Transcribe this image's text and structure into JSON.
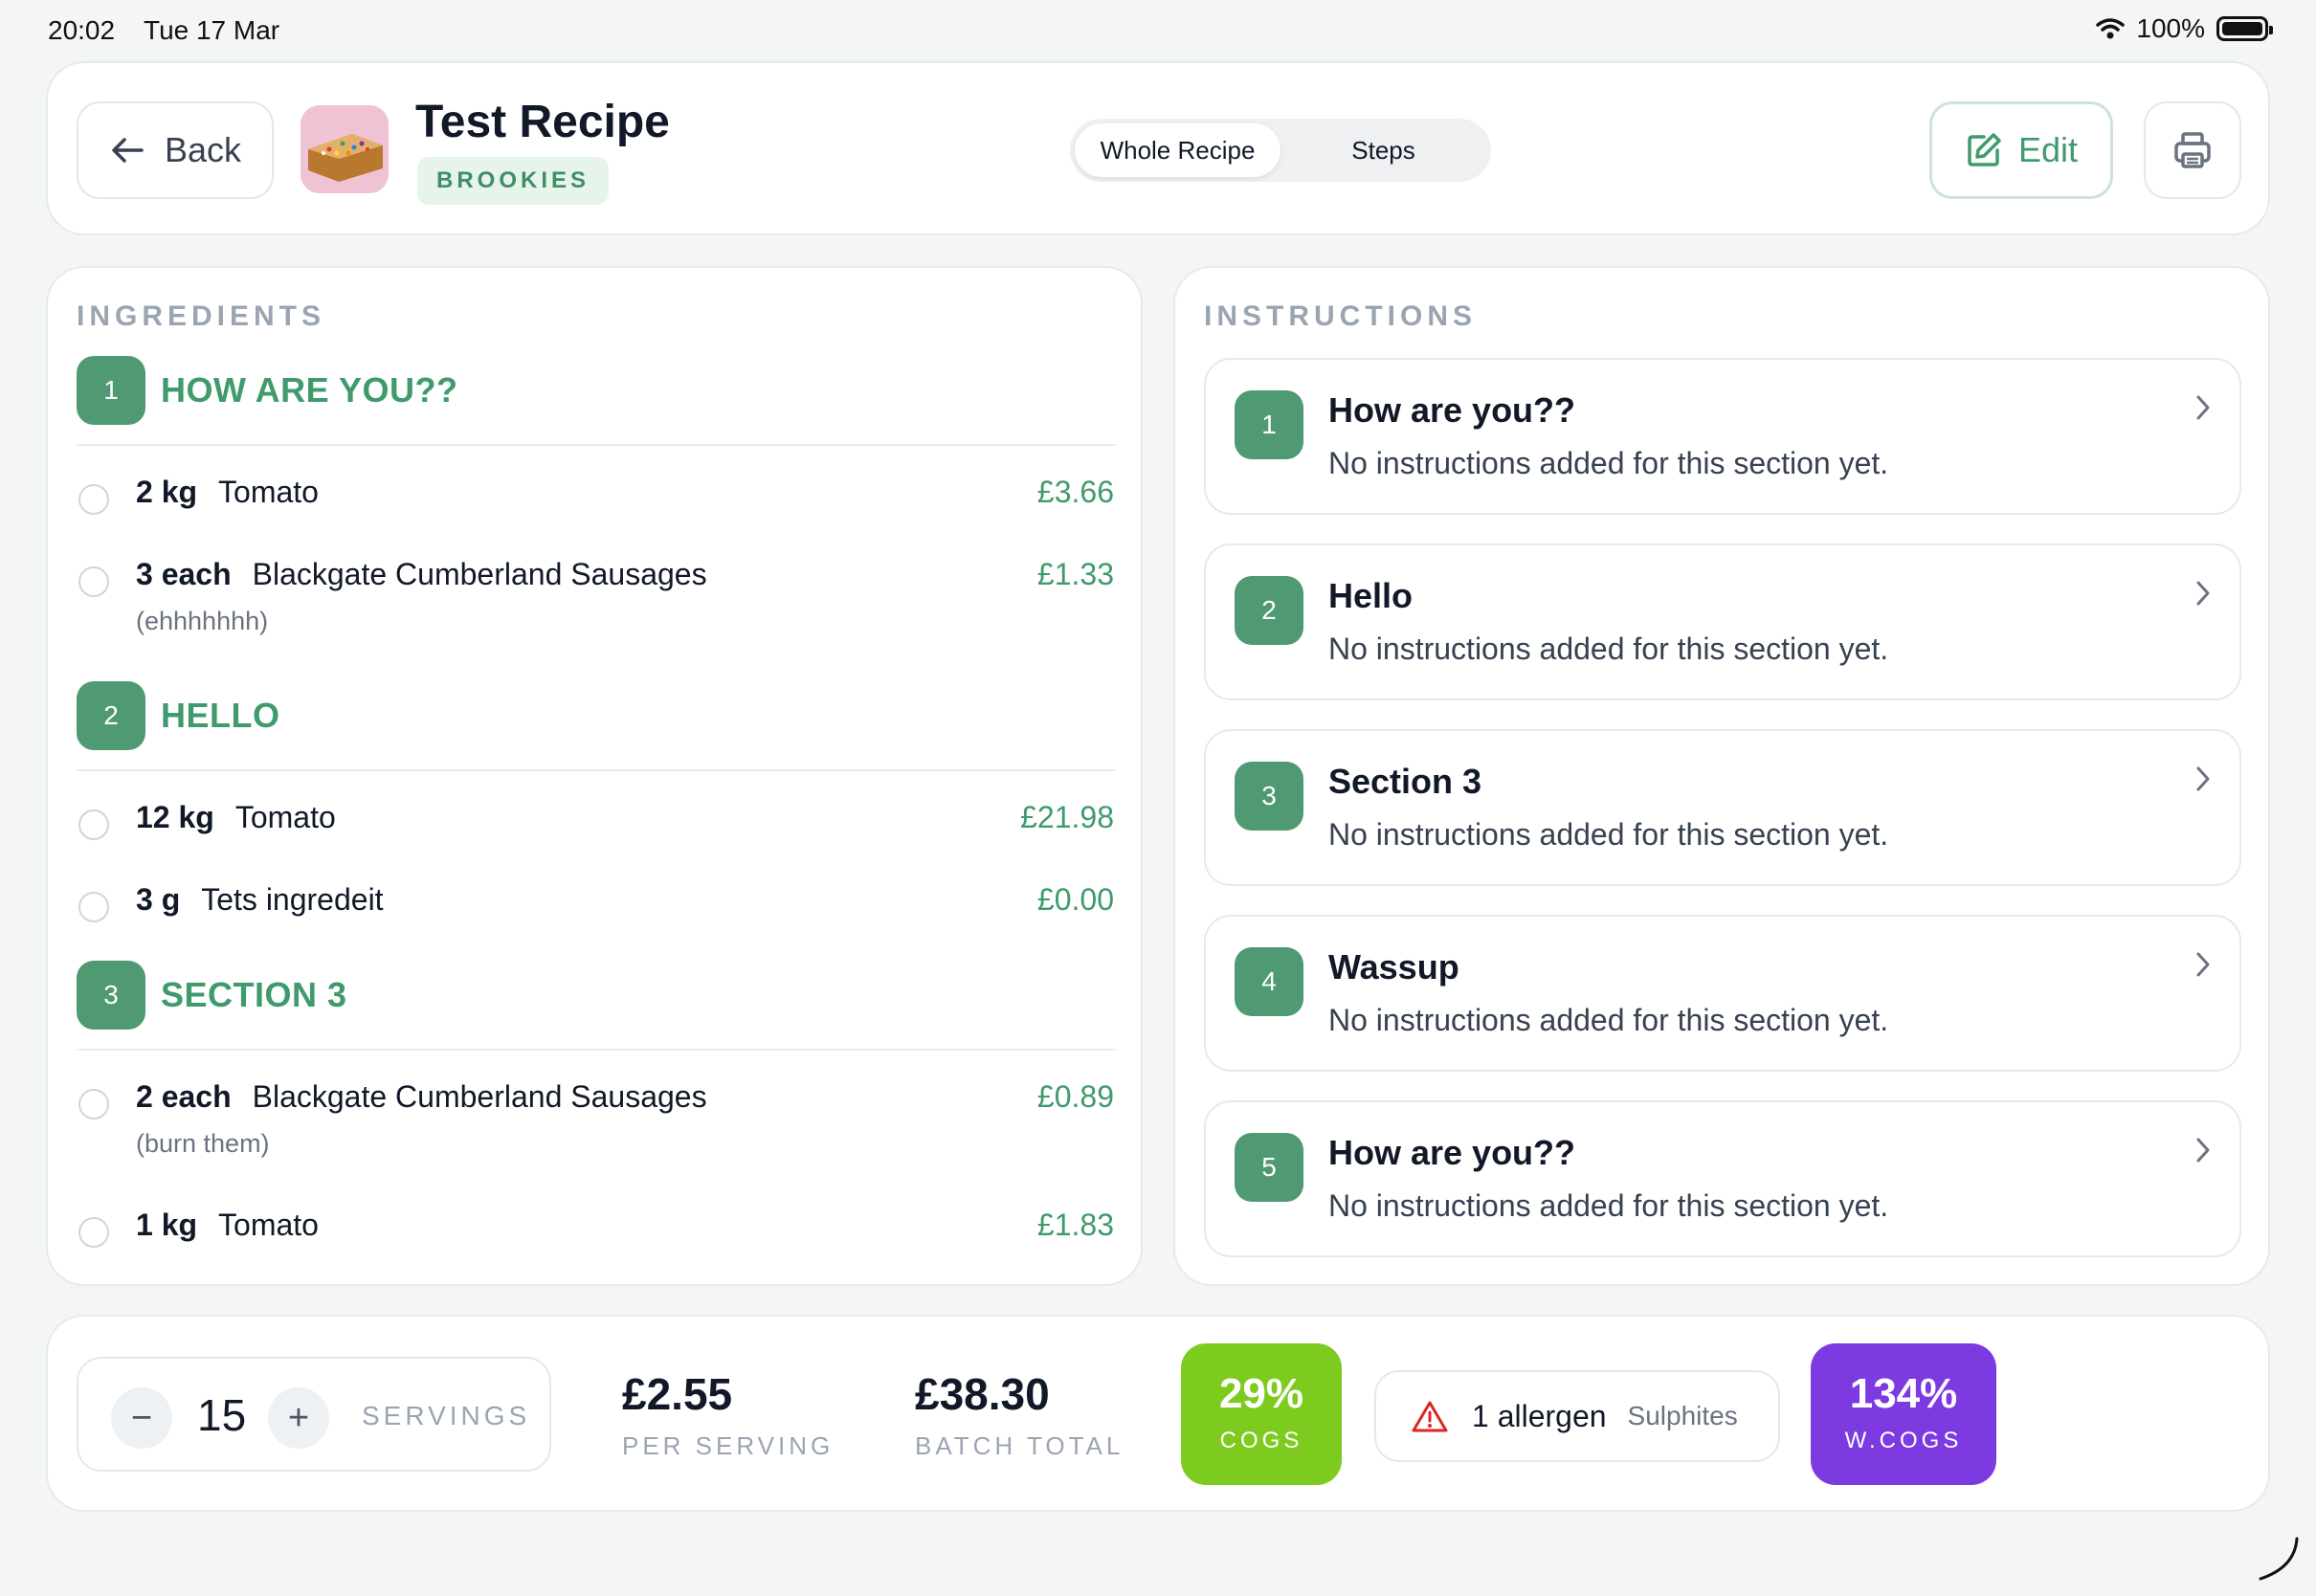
{
  "status": {
    "time": "20:02",
    "date": "Tue 17 Mar",
    "battery": "100%"
  },
  "header": {
    "back_label": "Back",
    "title": "Test Recipe",
    "category": "BROOKIES",
    "tabs": [
      {
        "label": "Whole Recipe",
        "active": true
      },
      {
        "label": "Steps",
        "active": false
      }
    ],
    "edit_label": "Edit"
  },
  "ingredients": {
    "label": "INGREDIENTS",
    "sections": [
      {
        "num": "1",
        "name": "HOW ARE YOU??",
        "items": [
          {
            "qty": "2 kg",
            "name": "Tomato",
            "price": "£3.66",
            "note": ""
          },
          {
            "qty": "3 each",
            "name": "Blackgate Cumberland Sausages",
            "price": "£1.33",
            "note": "(ehhhhhhh)"
          }
        ]
      },
      {
        "num": "2",
        "name": "HELLO",
        "items": [
          {
            "qty": "12 kg",
            "name": "Tomato",
            "price": "£21.98",
            "note": ""
          },
          {
            "qty": "3 g",
            "name": "Tets ingredeit",
            "price": "£0.00",
            "note": ""
          }
        ]
      },
      {
        "num": "3",
        "name": "SECTION 3",
        "items": [
          {
            "qty": "2 each",
            "name": "Blackgate Cumberland Sausages",
            "price": "£0.89",
            "note": "(burn them)"
          },
          {
            "qty": "1 kg",
            "name": "Tomato",
            "price": "£1.83",
            "note": ""
          }
        ]
      }
    ]
  },
  "instructions": {
    "label": "INSTRUCTIONS",
    "cards": [
      {
        "num": "1",
        "title": "How are you??",
        "text": "No instructions added for this section yet."
      },
      {
        "num": "2",
        "title": "Hello",
        "text": "No instructions added for this section yet."
      },
      {
        "num": "3",
        "title": "Section 3",
        "text": "No instructions added for this section yet."
      },
      {
        "num": "4",
        "title": "Wassup",
        "text": "No instructions added for this section yet."
      },
      {
        "num": "5",
        "title": "How are you??",
        "text": "No instructions added for this section yet."
      }
    ]
  },
  "footer": {
    "servings": "15",
    "servings_label": "SERVINGS",
    "minus": "−",
    "plus": "+",
    "per_serving": "£2.55",
    "per_serving_label": "PER SERVING",
    "batch_total": "£38.30",
    "batch_total_label": "BATCH TOTAL",
    "cogs": "29%",
    "cogs_label": "COGS",
    "allergen_count": "1 allergen",
    "allergen_names": "Sulphites",
    "wcogs": "134%",
    "wcogs_label": "W.COGS"
  },
  "colors": {
    "brand_green": "#4f9a72",
    "cogs_green": "#7ecb20",
    "wcogs_purple": "#7c3ae0",
    "warning_red": "#dc2626"
  }
}
